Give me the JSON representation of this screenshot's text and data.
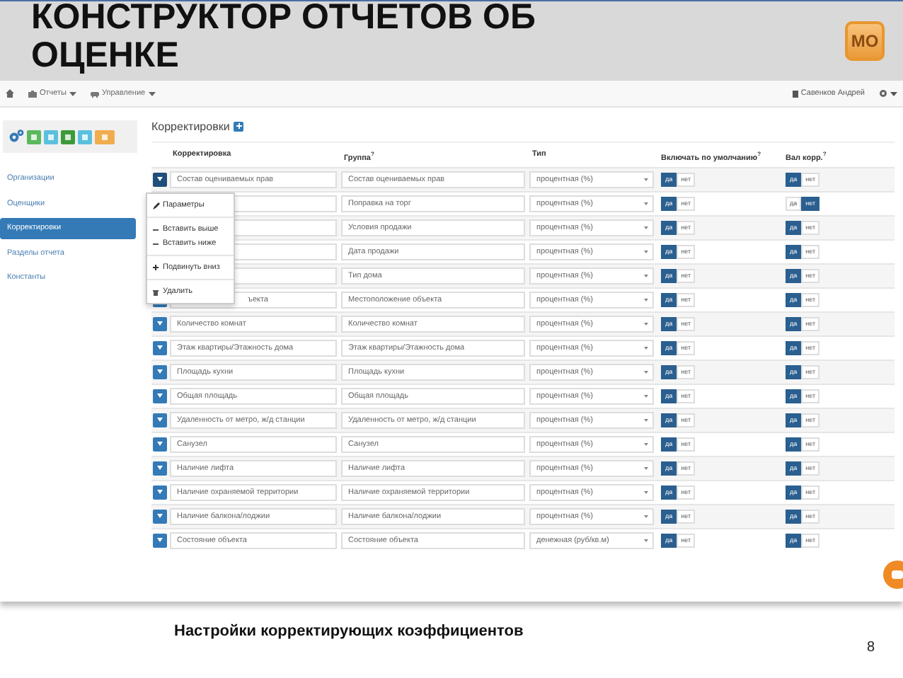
{
  "slide": {
    "title": "КОНСТРУКТОР ОТЧЕТОВ ОБ ОЦЕНКЕ",
    "logo": "МО",
    "caption": "Настройки корректирующих коэффициентов",
    "page_number": "8"
  },
  "navbar": {
    "menus": [
      "Отчеты",
      "Управление"
    ],
    "user": "Савенков Андрей"
  },
  "sidebar": {
    "items": [
      {
        "label": "Организации",
        "selected": false
      },
      {
        "label": "Оценщики",
        "selected": false
      },
      {
        "label": "Корректировки",
        "selected": true
      },
      {
        "label": "Разделы отчета",
        "selected": false
      },
      {
        "label": "Константы",
        "selected": false
      }
    ]
  },
  "page": {
    "heading": "Корректировки",
    "columns": [
      "Корректировка",
      "Группа$^{?}$",
      "Тип",
      "Включать по умолчанию$^{?}$",
      "Вал корр.$^{?}$"
    ]
  },
  "rows": [
    {
      "correction": "Состав оцениваемых прав",
      "open": true,
      "group": "Состав оцениваемых прав",
      "type": "процентная (%)",
      "include": [
        {
          "label": "да",
          "selected": true
        },
        {
          "label": "нет",
          "selected": false
        }
      ],
      "value": [
        {
          "label": "да",
          "selected": true
        },
        {
          "label": "нет",
          "selected": false
        }
      ]
    },
    {
      "group": "Поправка на торг",
      "type": "процентная (%)",
      "include": [
        {
          "label": "да",
          "selected": true
        },
        {
          "label": "нет",
          "selected": false
        }
      ],
      "value": [
        {
          "label": "да",
          "selected": false
        },
        {
          "label": "нет",
          "selected": true
        }
      ]
    },
    {
      "group": "Условия продажи",
      "type": "процентная (%)",
      "include": [
        {
          "label": "да",
          "selected": true
        },
        {
          "label": "нет",
          "selected": false
        }
      ],
      "value": [
        {
          "label": "да",
          "selected": true
        },
        {
          "label": "нет",
          "selected": false
        }
      ]
    },
    {
      "group": "Дата продажи",
      "type": "процентная (%)",
      "include": [
        {
          "label": "да",
          "selected": true
        },
        {
          "label": "нет",
          "selected": false
        }
      ],
      "value": [
        {
          "label": "да",
          "selected": true
        },
        {
          "label": "нет",
          "selected": false
        }
      ]
    },
    {
      "group": "Тип дома",
      "type": "процентная (%)",
      "include": [
        {
          "label": "да",
          "selected": true
        },
        {
          "label": "нет",
          "selected": false
        }
      ],
      "value": [
        {
          "label": "да",
          "selected": true
        },
        {
          "label": "нет",
          "selected": false
        }
      ]
    },
    {
      "correction": "ъекта",
      "open": false,
      "group": "Местоположение объекта",
      "type": "процентная (%)",
      "include": [
        {
          "label": "да",
          "selected": true
        },
        {
          "label": "нет",
          "selected": false
        }
      ],
      "value": [
        {
          "label": "да",
          "selected": true
        },
        {
          "label": "нет",
          "selected": false
        }
      ]
    },
    {
      "correction": "Количество комнат",
      "open": false,
      "group": "Количество комнат",
      "type": "процентная (%)",
      "include": [
        {
          "label": "да",
          "selected": true
        },
        {
          "label": "нет",
          "selected": false
        }
      ],
      "value": [
        {
          "label": "да",
          "selected": true
        },
        {
          "label": "нет",
          "selected": false
        }
      ]
    },
    {
      "correction": "Этаж квартиры/Этажность дома",
      "open": false,
      "group": "Этаж квартиры/Этажность дома",
      "type": "процентная (%)",
      "include": [
        {
          "label": "да",
          "selected": true
        },
        {
          "label": "нет",
          "selected": false
        }
      ],
      "value": [
        {
          "label": "да",
          "selected": true
        },
        {
          "label": "нет",
          "selected": false
        }
      ]
    },
    {
      "correction": "Площадь кухни",
      "open": false,
      "group": "Площадь кухни",
      "type": "процентная (%)",
      "include": [
        {
          "label": "да",
          "selected": true
        },
        {
          "label": "нет",
          "selected": false
        }
      ],
      "value": [
        {
          "label": "да",
          "selected": true
        },
        {
          "label": "нет",
          "selected": false
        }
      ]
    },
    {
      "correction": "Общая площадь",
      "open": false,
      "group": "Общая площадь",
      "type": "процентная (%)",
      "include": [
        {
          "label": "да",
          "selected": true
        },
        {
          "label": "нет",
          "selected": false
        }
      ],
      "value": [
        {
          "label": "да",
          "selected": true
        },
        {
          "label": "нет",
          "selected": false
        }
      ]
    },
    {
      "correction": "Удаленность от метро, ж/д станции",
      "open": false,
      "group": "Удаленность от метро, ж/д станции",
      "type": "процентная (%)",
      "include": [
        {
          "label": "да",
          "selected": true
        },
        {
          "label": "нет",
          "selected": false
        }
      ],
      "value": [
        {
          "label": "да",
          "selected": true
        },
        {
          "label": "нет",
          "selected": false
        }
      ]
    },
    {
      "correction": "Санузел",
      "open": false,
      "group": "Санузел",
      "type": "процентная (%)",
      "include": [
        {
          "label": "да",
          "selected": true
        },
        {
          "label": "нет",
          "selected": false
        }
      ],
      "value": [
        {
          "label": "да",
          "selected": true
        },
        {
          "label": "нет",
          "selected": false
        }
      ]
    },
    {
      "correction": "Наличие лифта",
      "open": false,
      "group": "Наличие лифта",
      "type": "процентная (%)",
      "include": [
        {
          "label": "да",
          "selected": true
        },
        {
          "label": "нет",
          "selected": false
        }
      ],
      "value": [
        {
          "label": "да",
          "selected": true
        },
        {
          "label": "нет",
          "selected": false
        }
      ]
    },
    {
      "correction": "Наличие охраняемой территории",
      "open": false,
      "group": "Наличие охраняемой территории",
      "type": "процентная (%)",
      "include": [
        {
          "label": "да",
          "selected": true
        },
        {
          "label": "нет",
          "selected": false
        }
      ],
      "value": [
        {
          "label": "да",
          "selected": true
        },
        {
          "label": "нет",
          "selected": false
        }
      ]
    },
    {
      "correction": "Наличие балкона/лоджии",
      "open": false,
      "group": "Наличие балкона/лоджии",
      "type": "процентная (%)",
      "include": [
        {
          "label": "да",
          "selected": true
        },
        {
          "label": "нет",
          "selected": false
        }
      ],
      "value": [
        {
          "label": "да",
          "selected": true
        },
        {
          "label": "нет",
          "selected": false
        }
      ]
    },
    {
      "correction": "Состояние объекта",
      "open": false,
      "group": "Состояние объекта",
      "type": "денежная (руб/кв.м)",
      "include": [
        {
          "label": "да",
          "selected": true
        },
        {
          "label": "нет",
          "selected": false
        }
      ],
      "value": [
        {
          "label": "да",
          "selected": true
        },
        {
          "label": "нет",
          "selected": false
        }
      ]
    }
  ],
  "row_menu": {
    "items": [
      {
        "kind": "edit",
        "label": "Параметры"
      },
      {
        "kind": "divider"
      },
      {
        "kind": "insert",
        "label": "Вставить выше"
      },
      {
        "kind": "insert",
        "label": "Вставить ниже"
      },
      {
        "kind": "divider"
      },
      {
        "kind": "move",
        "label": "Подвинуть вниз"
      },
      {
        "kind": "divider"
      },
      {
        "kind": "delete",
        "label": "Удалить"
      }
    ]
  }
}
